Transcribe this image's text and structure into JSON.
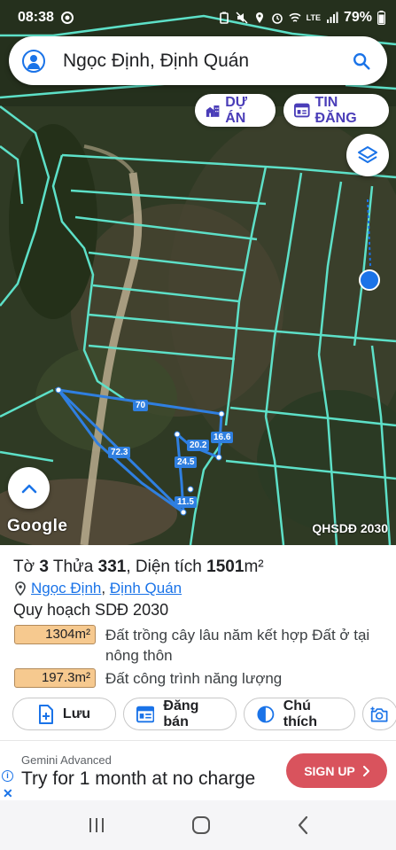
{
  "status_bar": {
    "time": "08:38",
    "battery": "79%",
    "network": "LTE"
  },
  "search": {
    "value": "Ngọc Định, Định Quán",
    "icons": [
      "account-icon",
      "search-icon"
    ]
  },
  "map_buttons": {
    "du_an": "DỰ ÁN",
    "tin_dang": "TIN ĐĂNG",
    "layers_icon": "layers-icon",
    "expand_icon": "chevron-up-icon"
  },
  "map": {
    "google_label": "Google",
    "plan_label": "QHSDĐ 2030",
    "measurements": [
      "70",
      "72.3",
      "16.6",
      "20.2",
      "24.5",
      "11.5"
    ]
  },
  "lot": {
    "prefix_to": "Tờ",
    "to_number": "3",
    "prefix_thua": "Thửa",
    "thua_number": "331",
    "area_label": "Diện tích",
    "area_value": "1501",
    "area_unit": "m²",
    "commune": "Ngọc Định",
    "district": "Định Quán",
    "separator": ",",
    "plan_title": "Quy hoạch SDĐ 2030",
    "land_uses": [
      {
        "area": "1304m²",
        "description": "Đất trồng cây lâu năm kết hợp Đất ở tại nông thôn",
        "color": "#f6c98f"
      },
      {
        "area": "197.3m²",
        "description": "Đất công trình năng lượng",
        "color": "#f6c98f"
      }
    ]
  },
  "actions": {
    "save": "Lưu",
    "post_sale": "Đăng bán",
    "legend": "Chú thích"
  },
  "ad": {
    "brand": "Gemini Advanced",
    "headline": "Try for 1 month at no charge",
    "cta": "SIGN UP",
    "cta_color": "#d9535d"
  },
  "colors": {
    "accent": "#1a73e8",
    "pill_text": "#4a3db8",
    "parcel_line": "#5de0c8",
    "measure_line": "#2f7fe0"
  }
}
